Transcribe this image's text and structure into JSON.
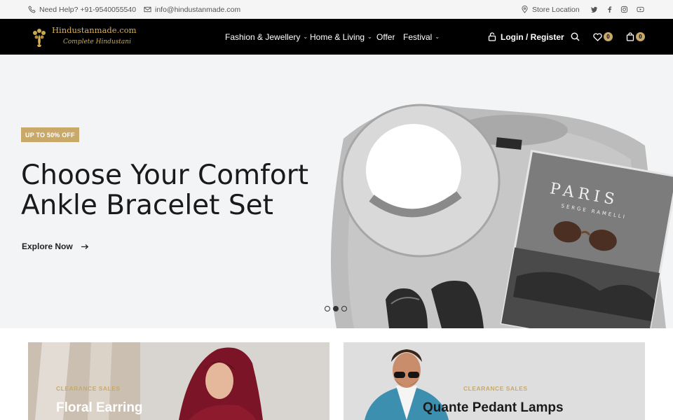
{
  "topbar": {
    "help": "Need Help? +91-9540055540",
    "email": "info@hindustanmade.com",
    "store": "Store Location",
    "social_icons": [
      "twitter-icon",
      "facebook-icon",
      "instagram-icon",
      "youtube-icon"
    ]
  },
  "header": {
    "logo_name": "Hindustanmade.com",
    "logo_tagline": "Complete Hindustani",
    "nav": [
      {
        "label": "Fashion & Jewellery",
        "has_dropdown": true
      },
      {
        "label": "Home & Living",
        "has_dropdown": true
      },
      {
        "label": "Offer",
        "has_dropdown": false
      },
      {
        "label": "Festival",
        "has_dropdown": true
      }
    ],
    "login": "Login / Register",
    "wishlist_count": "0",
    "cart_count": "0"
  },
  "hero": {
    "tag": "UP TO 50% OFF",
    "title_line1": "Choose Your Comfort",
    "title_line2": "Ankle Bracelet Set",
    "cta": "Explore Now",
    "book_title": "PARIS",
    "book_author": "SERGE RAMELLI",
    "slides": 3,
    "active_slide": 2
  },
  "promos": [
    {
      "sub": "CLEARANCE SALES",
      "title": "Floral Earring"
    },
    {
      "sub": "CLEARANCE SALES",
      "title": "Quante Pedant Lamps"
    }
  ],
  "colors": {
    "accent": "#c8a96a",
    "header_bg": "#000000",
    "hero_bg": "#f3f4f6"
  }
}
